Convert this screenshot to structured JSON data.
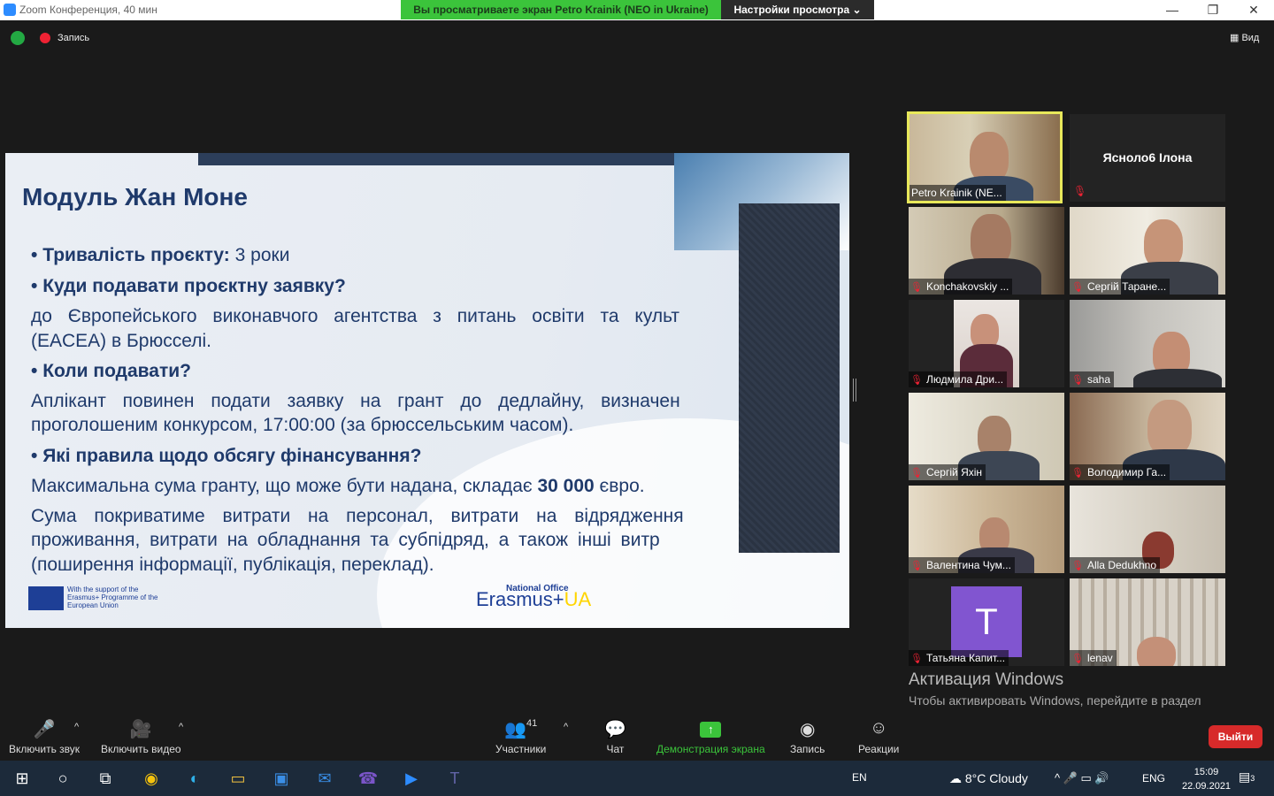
{
  "window": {
    "title": "Zoom Конференция, 40 мин",
    "banner": "Вы просматриваете экран Petro Krainik (NEO in Ukraine)",
    "view_options": "Настройки просмотра ⌄",
    "minimize": "—",
    "restore": "❐",
    "close": "✕"
  },
  "topbar": {
    "recording_label": "Запись",
    "view_label": "Вид"
  },
  "slide": {
    "title": "Модуль Жан Моне",
    "lines": [
      {
        "bold": "Тривалість проєкту:",
        "text": " 3 роки"
      },
      {
        "bold": "Куди подавати проєктну заявку?",
        "text": ""
      },
      {
        "bold": "",
        "text": "до Європейського виконавчого агентства з питань освіти та культ"
      },
      {
        "bold": "",
        "text": "(EACEA) в Брюсселі."
      },
      {
        "bold": "Коли подавати?",
        "text": ""
      },
      {
        "bold": "",
        "text": "Аплікант повинен подати заявку на грант до дедлайну, визначен"
      },
      {
        "bold": "",
        "text": "проголошеним конкурсом, 17:00:00 (за брюссельським часом)."
      },
      {
        "bold": "Які правила щодо обсягу фінансування?",
        "text": ""
      },
      {
        "bold": "",
        "text": "Максимальна сума гранту, що може бути надана, складає "
      },
      {
        "bold": "",
        "text": "Сума покриватиме витрати на персонал, витрати на відрядження"
      },
      {
        "bold": "",
        "text": "проживання, витрати на обладнання та субпідряд, а також інші витр"
      },
      {
        "bold": "",
        "text": "(поширення інформації, публікація, переклад)."
      }
    ],
    "max_amount": "30 000",
    "max_amount_suffix": " євро.",
    "eu_support": "With the support of the Erasmus+ Programme of the European Union",
    "erasmus_office": "National Office",
    "erasmus_name": "Erasmus+",
    "erasmus_ua": "UA"
  },
  "participants": [
    {
      "name": "Petro Krainik (NE...",
      "muted": true,
      "active": true
    },
    {
      "name": "Ясноло6 Ілона",
      "muted": true
    },
    {
      "name": "Konchakovskiy ...",
      "muted": true
    },
    {
      "name": "Сергій Таране...",
      "muted": true
    },
    {
      "name": "Людмила Дри...",
      "muted": true
    },
    {
      "name": "saha",
      "muted": true
    },
    {
      "name": "Сергій Яхін",
      "muted": true
    },
    {
      "name": "Володимир Га...",
      "muted": true
    },
    {
      "name": "Валентина Чум...",
      "muted": true
    },
    {
      "name": "Alla Dedukhno",
      "muted": true
    },
    {
      "name": "Татьяна Капит...",
      "muted": true,
      "avatar": "T"
    },
    {
      "name": "lenav",
      "muted": true
    }
  ],
  "activation": {
    "title": "Активация Windows",
    "text": "Чтобы активировать Windows, перейдите в раздел \"Параметры\"."
  },
  "toolbar": {
    "audio": "Включить звук",
    "video": "Включить видео",
    "participants": "Участники",
    "participants_count": "41",
    "chat": "Чат",
    "share": "Демонстрация экрана",
    "record": "Запись",
    "reactions": "Реакции",
    "exit": "Выйти"
  },
  "taskbar": {
    "en": "EN",
    "weather": "8°C  Cloudy",
    "lang": "ENG",
    "time": "15:09",
    "date": "22.09.2021",
    "notifications": "3"
  },
  "colors": {
    "share_green": "#3bc43b",
    "exit_red": "#d72a2a",
    "slide_blue": "#1f3a6b",
    "active_border": "#e8e85a"
  }
}
